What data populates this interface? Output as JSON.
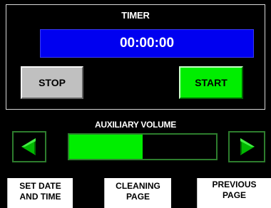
{
  "timer": {
    "title": "TIMER",
    "display": "00:00:00",
    "stop_label": "STOP",
    "start_label": "START"
  },
  "auxiliary": {
    "title": "AUXILIARY VOLUME",
    "level_fraction": 0.5,
    "decrease_icon": "triangle-left-icon",
    "increase_icon": "triangle-right-icon"
  },
  "nav": {
    "set_date_line1": "SET DATE",
    "set_date_line2": "AND TIME",
    "cleaning_line1": "CLEANING",
    "cleaning_line2": "PAGE",
    "previous_line1": "PREVIOUS",
    "previous_line2": "PAGE"
  },
  "colors": {
    "display_blue": "#0000f0",
    "active_green": "#00ee00",
    "button_gray": "#c0c0c0",
    "background": "#000000"
  }
}
